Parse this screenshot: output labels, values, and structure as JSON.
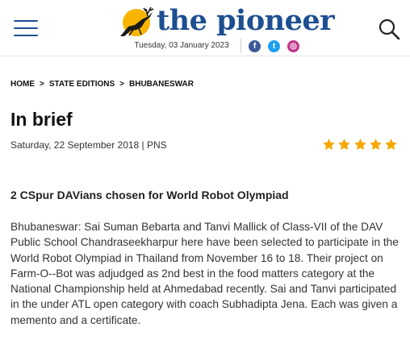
{
  "header": {
    "logo_text": "the pioneer",
    "date": "Tuesday, 03 January 2023",
    "social": [
      {
        "icon": "facebook-icon",
        "glyph": "f",
        "color": "#3b5998"
      },
      {
        "icon": "twitter-icon",
        "glyph": "t",
        "color": "#1da1f2"
      },
      {
        "icon": "instagram-icon",
        "glyph": "◎",
        "color": "#c1358b"
      }
    ]
  },
  "breadcrumb": [
    "HOME",
    "STATE EDITIONS",
    "BHUBANESWAR"
  ],
  "breadcrumb_separator": ">",
  "article": {
    "title": "In brief",
    "meta": "Saturday, 22 September 2018 | PNS",
    "rating": 5,
    "rating_max": 5,
    "headline": "2 CSpur DAVians chosen for World Robot Olympiad",
    "body": "Bhubaneswar: Sai Suman Bebarta and Tanvi Mallick of Class-VII of the DAV Public School Chandraseekharpur here have been selected to participate in the World Robot Olympiad in Thailand from November 16 to 18. Their project on Farm-O--Bot was adjudged as 2nd best in the food matters category at the National Championship held at Ahmedabad recently. Sai and Tanvi participated in the under ATL open category with coach Subhadipta Jena. Each was given a memento and a certificate."
  },
  "colors": {
    "brand": "#1d4f91",
    "star": "#f5a800",
    "logo_circle": "#f7b500"
  }
}
